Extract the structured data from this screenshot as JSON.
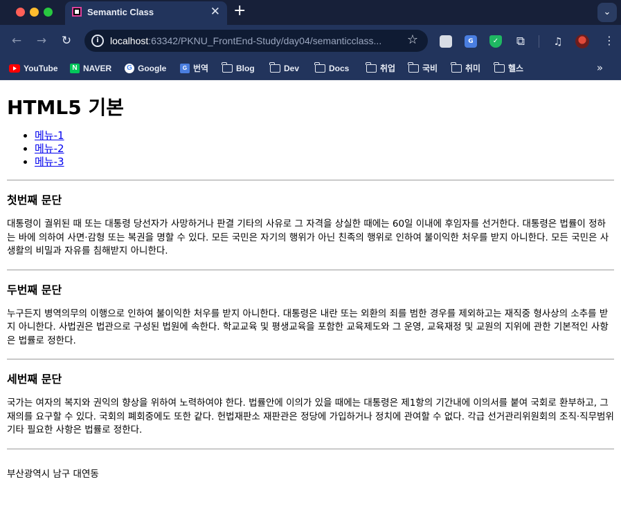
{
  "browser": {
    "tab_title": "Semantic Class",
    "tab_close": "✕",
    "new_tab": "+",
    "tab_search": "⌄",
    "nav_back": "←",
    "nav_forward": "→",
    "nav_reload": "↻",
    "url_host": "localhost",
    "url_rest": ":63342/PKNU_FrontEnd-Study/day04/semanticclass...",
    "star": "☆",
    "menu": "⋮",
    "bookmarks": [
      {
        "label": "YouTube",
        "icon": "youtube-icon"
      },
      {
        "label": "NAVER",
        "icon": "naver-icon"
      },
      {
        "label": "Google",
        "icon": "google-icon"
      },
      {
        "label": "번역",
        "icon": "translate-icon"
      },
      {
        "label": "Blog",
        "icon": "folder-icon"
      },
      {
        "label": "Dev",
        "icon": "folder-icon"
      },
      {
        "label": "Docs",
        "icon": "folder-icon"
      },
      {
        "label": "취업",
        "icon": "folder-icon"
      },
      {
        "label": "국비",
        "icon": "folder-icon"
      },
      {
        "label": "취미",
        "icon": "folder-icon"
      },
      {
        "label": "헬스",
        "icon": "folder-icon"
      }
    ],
    "bookmarks_more": "»"
  },
  "page": {
    "title": "HTML5 기본",
    "nav": [
      "메뉴-1",
      "메뉴-2",
      "메뉴-3"
    ],
    "sections": [
      {
        "heading": "첫번째 문단",
        "text": "대통령이 궐위된 때 또는 대통령 당선자가 사망하거나 판결 기타의 사유로 그 자격을 상실한 때에는 60일 이내에 후임자를 선거한다. 대통령은 법률이 정하는 바에 의하여 사면·감형 또는 복권을 명할 수 있다. 모든 국민은 자기의 행위가 아닌 친족의 행위로 인하여 불이익한 처우를 받지 아니한다. 모든 국민은 사생활의 비밀과 자유를 침해받지 아니한다."
      },
      {
        "heading": "두번째 문단",
        "text": "누구든지 병역의무의 이행으로 인하여 불이익한 처우를 받지 아니한다. 대통령은 내란 또는 외환의 죄를 범한 경우를 제외하고는 재직중 형사상의 소추를 받지 아니한다. 사법권은 법관으로 구성된 법원에 속한다. 학교교육 및 평생교육을 포함한 교육제도와 그 운영, 교육재정 및 교원의 지위에 관한 기본적인 사항은 법률로 정한다."
      },
      {
        "heading": "세번째 문단",
        "text": "국가는 여자의 복지와 권익의 향상을 위하여 노력하여야 한다. 법률안에 이의가 있을 때에는 대통령은 제1항의 기간내에 이의서를 붙여 국회로 환부하고, 그 재의를 요구할 수 있다. 국회의 폐회중에도 또한 같다. 헌법재판소 재판관은 정당에 가입하거나 정치에 관여할 수 없다. 각급 선거관리위원회의 조직·직무범위 기타 필요한 사항은 법률로 정한다."
      }
    ],
    "footer_address": "부산광역시 남구 대연동"
  }
}
